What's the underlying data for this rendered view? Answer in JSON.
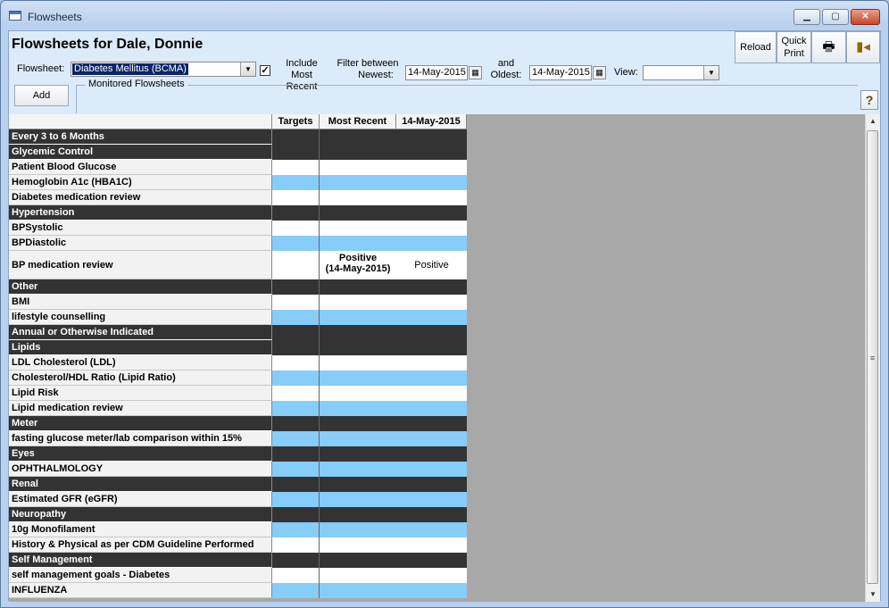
{
  "window": {
    "title": "Flowsheets",
    "min_icon": "minimize-icon",
    "max_icon": "maximize-icon",
    "close_icon": "close-icon"
  },
  "header": {
    "title": "Flowsheets for Dale, Donnie",
    "flowsheet_label": "Flowsheet:",
    "flowsheet_value": "Diabetes Mellitus (BCMA)",
    "include_most_recent_line1": "Include Most",
    "include_most_recent_line2": "Recent",
    "include_most_recent_checked": true,
    "filter_between_line1": "Filter between",
    "filter_between_line2": "Newest:",
    "newest_date": "14-May-2015",
    "and_line1": "and",
    "and_line2": "Oldest:",
    "oldest_date": "14-May-2015",
    "view_label": "View:",
    "view_value": ""
  },
  "toolbar": {
    "reload_label": "Reload",
    "quick_print_line1": "Quick",
    "quick_print_line2": "Print",
    "print_icon": "printer-icon",
    "exit_icon": "exit-door-icon"
  },
  "add_label": "Add",
  "monitored_label": "Monitored Flowsheets",
  "help_label": "?",
  "table": {
    "columns": [
      "",
      "Targets",
      "Most Recent",
      "14-May-2015"
    ],
    "rows": [
      {
        "label": "Every 3 to 6 Months",
        "type": "section"
      },
      {
        "label": "Glycemic Control",
        "type": "section"
      },
      {
        "label": "Patient Blood Glucose",
        "type": "white"
      },
      {
        "label": "Hemoglobin A1c (HBA1C)",
        "type": "blue"
      },
      {
        "label": "Diabetes medication review",
        "type": "white"
      },
      {
        "label": "Hypertension",
        "type": "section"
      },
      {
        "label": "BPSystolic",
        "type": "white"
      },
      {
        "label": "BPDiastolic",
        "type": "blue"
      },
      {
        "label": "BP medication review",
        "type": "white",
        "tall": true,
        "most_recent_line1": "Positive",
        "most_recent_line2": "(14-May-2015)",
        "date_value": "Positive"
      },
      {
        "label": "Other",
        "type": "section"
      },
      {
        "label": "BMI",
        "type": "white"
      },
      {
        "label": "lifestyle counselling",
        "type": "blue"
      },
      {
        "label": "Annual or Otherwise Indicated",
        "type": "section"
      },
      {
        "label": "Lipids",
        "type": "section"
      },
      {
        "label": "LDL Cholesterol (LDL)",
        "type": "white"
      },
      {
        "label": "Cholesterol/HDL Ratio (Lipid Ratio)",
        "type": "blue"
      },
      {
        "label": "Lipid Risk",
        "type": "white"
      },
      {
        "label": "Lipid medication review",
        "type": "blue"
      },
      {
        "label": "Meter",
        "type": "section"
      },
      {
        "label": "fasting glucose meter/lab comparison within 15%",
        "type": "blue"
      },
      {
        "label": "Eyes",
        "type": "section"
      },
      {
        "label": "OPHTHALMOLOGY",
        "type": "blue"
      },
      {
        "label": "Renal",
        "type": "section"
      },
      {
        "label": "Estimated GFR (eGFR)",
        "type": "blue"
      },
      {
        "label": "Neuropathy",
        "type": "section"
      },
      {
        "label": "10g Monofilament",
        "type": "blue"
      },
      {
        "label": "History & Physical as per CDM Guideline Performed",
        "type": "white"
      },
      {
        "label": "Self Management",
        "type": "section"
      },
      {
        "label": "self management goals - Diabetes",
        "type": "white"
      },
      {
        "label": "INFLUENZA",
        "type": "blue"
      }
    ]
  }
}
